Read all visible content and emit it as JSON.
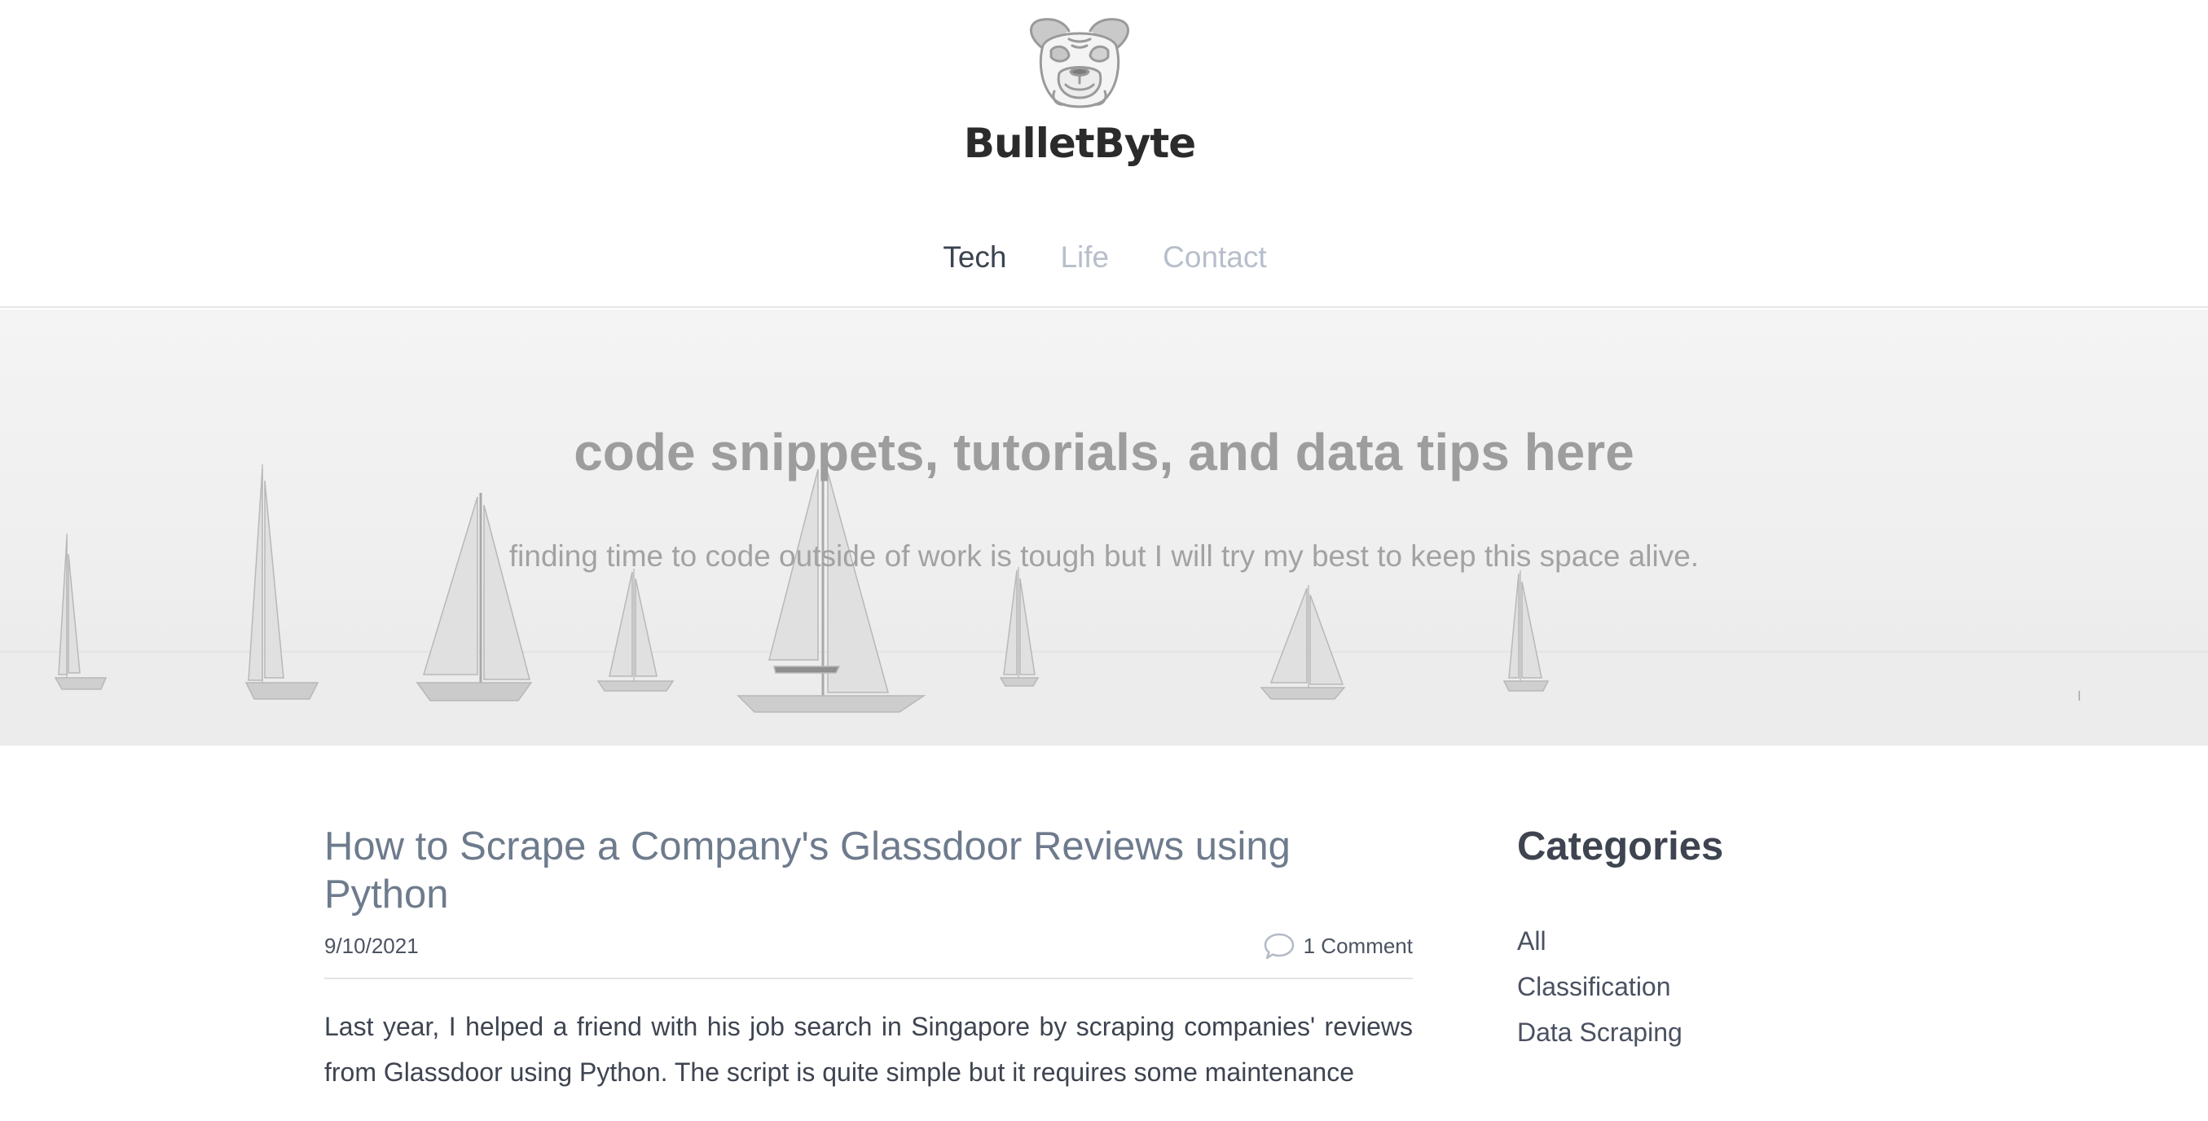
{
  "brand": {
    "name": "BulletByte",
    "logo_icon": "bulldog-icon"
  },
  "nav": {
    "items": [
      {
        "label": "Tech",
        "active": true
      },
      {
        "label": "Life",
        "active": false
      },
      {
        "label": "Contact",
        "active": false
      }
    ]
  },
  "hero": {
    "title": "code snippets, tutorials, and data tips here",
    "subtitle": "finding time to code outside of work is tough but I will try my best to keep this space alive."
  },
  "post": {
    "title": "How to Scrape a Company's Glassdoor Reviews using Python",
    "date": "9/10/2021",
    "comments_label": "1 Comment",
    "comments_icon": "comment-bubble-icon",
    "excerpt": "Last year, I helped a friend with his job search in Singapore by scraping companies' reviews from Glassdoor using Python. The script is quite simple but it requires some maintenance"
  },
  "sidebar": {
    "title": "Categories",
    "categories": [
      "All",
      "Classification",
      "Data Scraping"
    ]
  },
  "colors": {
    "nav_active": "#3c4350",
    "nav_inactive": "#b7becb",
    "post_title": "#6e7b8d",
    "hero_text": "#9d9d9d"
  }
}
